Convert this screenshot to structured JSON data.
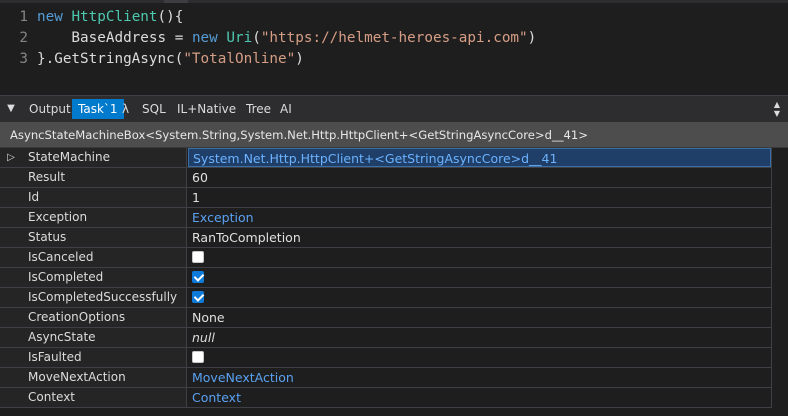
{
  "editor": {
    "lines": [
      {
        "number": "1",
        "tokens": [
          {
            "t": "new ",
            "c": "kw"
          },
          {
            "t": "HttpClient",
            "c": "ty"
          },
          {
            "t": "(){",
            "c": "pr"
          }
        ]
      },
      {
        "number": "2",
        "tokens": [
          {
            "t": "    BaseAddress = ",
            "c": "pr"
          },
          {
            "t": "new ",
            "c": "kw"
          },
          {
            "t": "Uri",
            "c": "ty"
          },
          {
            "t": "(",
            "c": "pr"
          },
          {
            "t": "\"https://helmet-heroes-api.com\"",
            "c": "st"
          },
          {
            "t": ")",
            "c": "pr"
          }
        ]
      },
      {
        "number": "3",
        "tokens": [
          {
            "t": "}.GetStringAsync(",
            "c": "pr"
          },
          {
            "t": "\"TotalOnline\"",
            "c": "st"
          },
          {
            "t": ")",
            "c": "pr"
          }
        ]
      }
    ]
  },
  "toolbar": {
    "toggle_icon": "triangle-down-icon",
    "tabs": [
      {
        "label": "Output",
        "active": false
      },
      {
        "label": "Task`1",
        "active": true
      },
      {
        "label": "λ",
        "active": false
      },
      {
        "label": "SQL",
        "active": false
      },
      {
        "label": "IL+Native",
        "active": false
      },
      {
        "label": "Tree",
        "active": false
      },
      {
        "label": "AI",
        "active": false
      }
    ]
  },
  "object_header": "AsyncStateMachineBox<System.String,System.Net.Http.HttpClient+<GetStringAsyncCore>d__41>",
  "properties": [
    {
      "name": "StateMachine",
      "value": "System.Net.Http.HttpClient+<GetStringAsyncCore>d__41",
      "kind": "link",
      "expandable": true,
      "selected": true
    },
    {
      "name": "Result",
      "value": "60",
      "kind": "text"
    },
    {
      "name": "Id",
      "value": "1",
      "kind": "text"
    },
    {
      "name": "Exception",
      "value": "Exception",
      "kind": "link"
    },
    {
      "name": "Status",
      "value": "RanToCompletion",
      "kind": "text"
    },
    {
      "name": "IsCanceled",
      "value": false,
      "kind": "checkbox"
    },
    {
      "name": "IsCompleted",
      "value": true,
      "kind": "checkbox"
    },
    {
      "name": "IsCompletedSuccessfully",
      "value": true,
      "kind": "checkbox"
    },
    {
      "name": "CreationOptions",
      "value": "None",
      "kind": "text"
    },
    {
      "name": "AsyncState",
      "value": "null",
      "kind": "italic"
    },
    {
      "name": "IsFaulted",
      "value": false,
      "kind": "checkbox"
    },
    {
      "name": "MoveNextAction",
      "value": "MoveNextAction",
      "kind": "link"
    },
    {
      "name": "Context",
      "value": "Context",
      "kind": "link"
    }
  ],
  "colors": {
    "accent": "#007acc",
    "link": "#5aa1f2",
    "keyword": "#569cd6",
    "type": "#4ec9b0",
    "string": "#d69d85"
  }
}
